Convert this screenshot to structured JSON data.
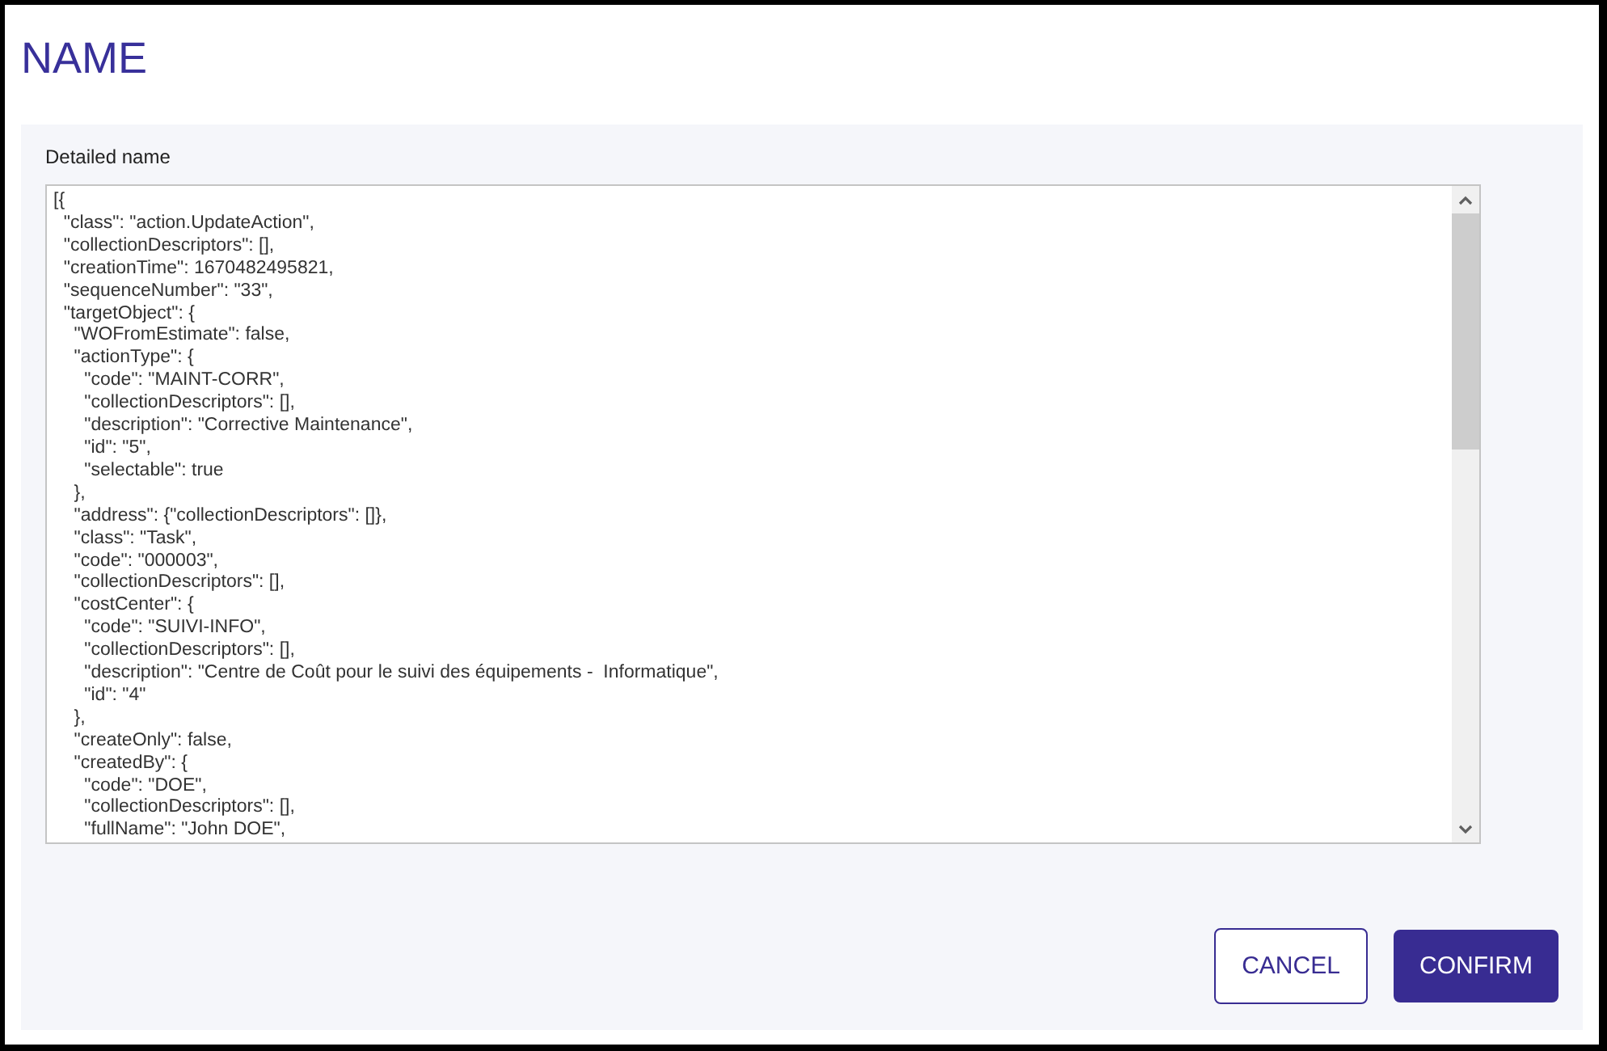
{
  "dialog": {
    "title": "NAME",
    "field": {
      "label": "Detailed name",
      "value": "[{\n  \"class\": \"action.UpdateAction\",\n  \"collectionDescriptors\": [],\n  \"creationTime\": 1670482495821,\n  \"sequenceNumber\": \"33\",\n  \"targetObject\": {\n    \"WOFromEstimate\": false,\n    \"actionType\": {\n      \"code\": \"MAINT-CORR\",\n      \"collectionDescriptors\": [],\n      \"description\": \"Corrective Maintenance\",\n      \"id\": \"5\",\n      \"selectable\": true\n    },\n    \"address\": {\"collectionDescriptors\": []},\n    \"class\": \"Task\",\n    \"code\": \"000003\",\n    \"collectionDescriptors\": [],\n    \"costCenter\": {\n      \"code\": \"SUIVI-INFO\",\n      \"collectionDescriptors\": [],\n      \"description\": \"Centre de Coût pour le suivi des équipements -  Informatique\",\n      \"id\": \"4\"\n    },\n    \"createOnly\": false,\n    \"createdBy\": {\n      \"code\": \"DOE\",\n      \"collectionDescriptors\": [],\n      \"fullName\": \"John DOE\","
    },
    "buttons": [
      {
        "label": "CANCEL",
        "kind": "secondary"
      },
      {
        "label": "CONFIRM",
        "kind": "primary"
      }
    ]
  }
}
